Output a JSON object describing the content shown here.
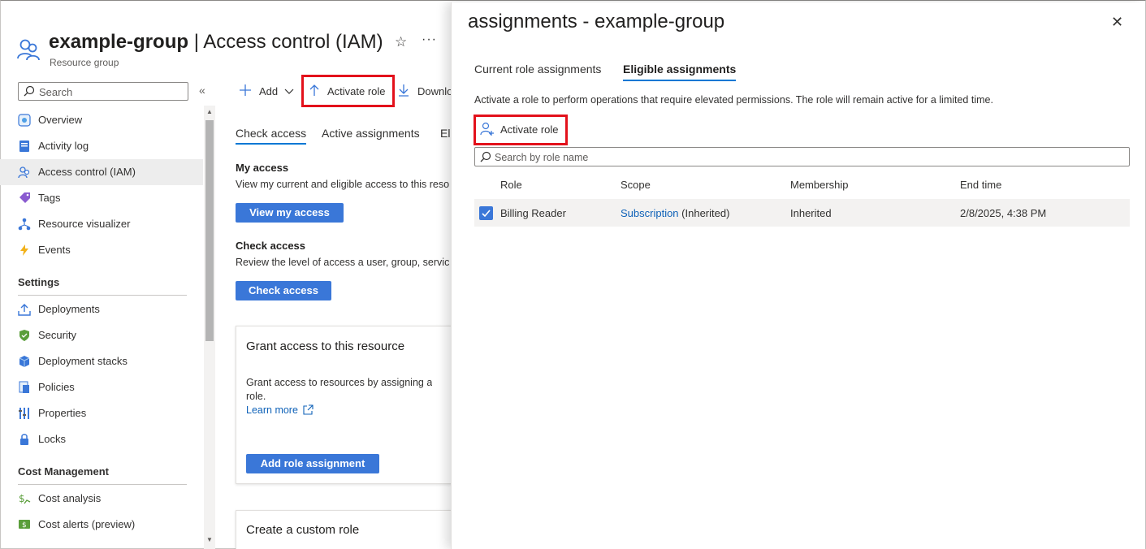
{
  "header": {
    "resource_name": "example-group",
    "separator": "|",
    "page_name": "Access control (IAM)",
    "resource_type": "Resource group",
    "star_glyph": "☆",
    "more_glyph": "···"
  },
  "sidebar": {
    "search_placeholder": "Search",
    "collapse_glyph": "«",
    "items_top": [
      {
        "label": "Overview",
        "icon": "overview-icon"
      },
      {
        "label": "Activity log",
        "icon": "activity-log-icon"
      },
      {
        "label": "Access control (IAM)",
        "icon": "iam-icon",
        "active": true
      },
      {
        "label": "Tags",
        "icon": "tag-icon"
      },
      {
        "label": "Resource visualizer",
        "icon": "visualizer-icon"
      },
      {
        "label": "Events",
        "icon": "lightning-icon"
      }
    ],
    "settings_heading": "Settings",
    "items_settings": [
      {
        "label": "Deployments",
        "icon": "upload-icon"
      },
      {
        "label": "Security",
        "icon": "shield-icon"
      },
      {
        "label": "Deployment stacks",
        "icon": "cube-icon"
      },
      {
        "label": "Policies",
        "icon": "policy-icon"
      },
      {
        "label": "Properties",
        "icon": "properties-icon"
      },
      {
        "label": "Locks",
        "icon": "lock-icon"
      }
    ],
    "cost_heading": "Cost Management",
    "items_cost": [
      {
        "label": "Cost analysis",
        "icon": "cost-analysis-icon"
      },
      {
        "label": "Cost alerts (preview)",
        "icon": "cost-alert-icon"
      }
    ]
  },
  "toolbar": {
    "add_label": "Add",
    "activate_role_label": "Activate role",
    "download_label": "Downlo"
  },
  "main": {
    "tabs": [
      "Check access",
      "Active assignments",
      "Eli"
    ],
    "my_access_heading": "My access",
    "my_access_desc": "View my current and eligible access to this reso",
    "view_my_access_button": "View my access",
    "check_access_heading": "Check access",
    "check_access_desc": "Review the level of access a user, group, servic",
    "check_access_button": "Check access",
    "grant_card": {
      "title": "Grant access to this resource",
      "desc_line1": "Grant access to resources by assigning a",
      "desc_line2": "role.",
      "learn_more": "Learn more",
      "button": "Add role assignment"
    },
    "custom_card": {
      "title": "Create a custom role"
    }
  },
  "panel": {
    "title": "assignments - example-group",
    "close_glyph": "✕",
    "tabs": [
      "Current role assignments",
      "Eligible assignments"
    ],
    "description": "Activate a role to perform operations that require elevated permissions. The role will remain active for a limited time.",
    "activate_role_label": "Activate role",
    "search_placeholder": "Search by role name",
    "columns": [
      "Role",
      "Scope",
      "Membership",
      "End time"
    ],
    "rows": [
      {
        "role": "Billing Reader",
        "scope_link": "Subscription",
        "scope_suffix": "(Inherited)",
        "membership": "Inherited",
        "end_time": "2/8/2025, 4:38 PM",
        "checked": true
      }
    ]
  },
  "colors": {
    "accent": "#0078d4",
    "primary_button": "#3a77d8",
    "highlight_red": "#e3111b",
    "link": "#0f62b8"
  }
}
